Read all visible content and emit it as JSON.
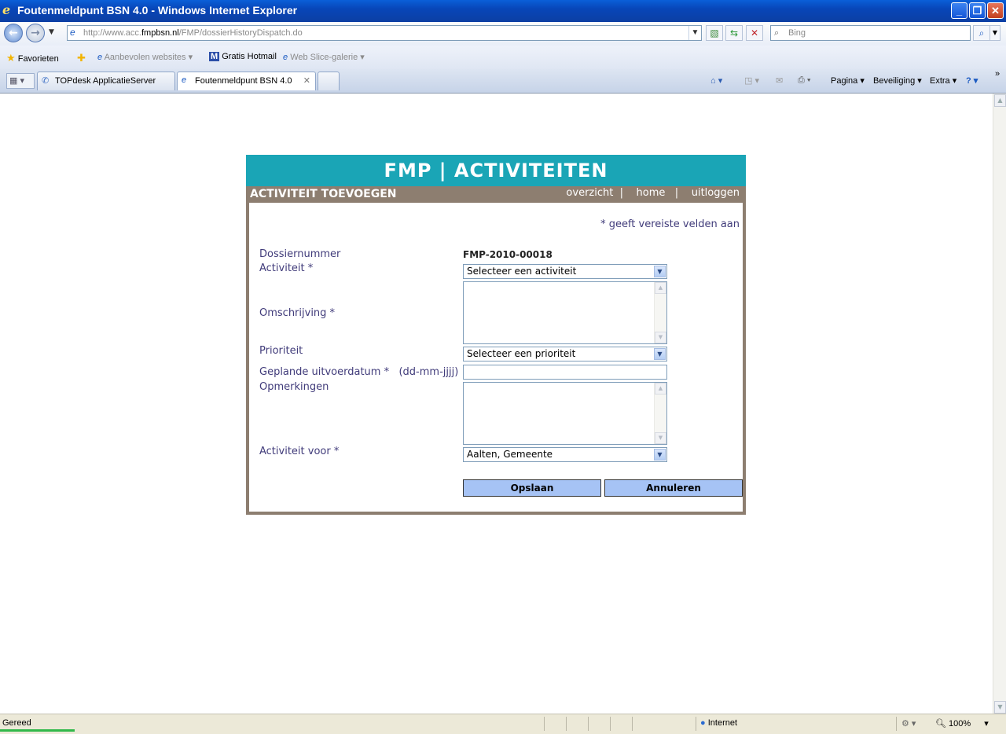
{
  "window": {
    "title": "Foutenmeldpunt BSN 4.0 - Windows Internet Explorer",
    "minimize": "_",
    "restore": "❐",
    "close": "✕"
  },
  "address": {
    "url_prefix": "http://www.acc.",
    "url_domain": "fmpbsn.nl",
    "url_suffix": "/FMP/dossierHistoryDispatch.do",
    "search_placeholder": "Bing"
  },
  "favorites": {
    "favorites_label": "Favorieten",
    "recommended": "Aanbevolen websites",
    "hotmail": "Gratis Hotmail",
    "slice_gallery": "Web Slice-galerie"
  },
  "tabs": [
    {
      "label": "TOPdesk ApplicatieServer"
    },
    {
      "label": "Foutenmeldpunt BSN 4.0"
    }
  ],
  "commandbar": {
    "page": "Pagina",
    "security": "Beveiliging",
    "extra": "Extra"
  },
  "status": {
    "text": "Gereed",
    "zone": "Internet",
    "zoom": "100%"
  },
  "panel": {
    "header": "FMP | ACTIVITEITEN",
    "subheader": "ACTIVITEIT TOEVOEGEN",
    "links": {
      "overview": "overzicht",
      "home": "home",
      "logout": "uitloggen"
    },
    "required_note": "* geeft vereiste velden aan",
    "form": {
      "dossier_label": "Dossiernummer",
      "dossier_value": "FMP-2010-00018",
      "activity_label": "Activiteit *",
      "activity_value": "Selecteer een activiteit",
      "description_label": "Omschrijving *",
      "priority_label": "Prioriteit",
      "priority_value": "Selecteer een prioriteit",
      "planned_date_label": "Geplande uitvoerdatum *   (dd-mm-jjjj)",
      "remarks_label": "Opmerkingen",
      "activity_for_label": "Activiteit voor *",
      "activity_for_value": "Aalten, Gemeente"
    },
    "buttons": {
      "save": "Opslaan",
      "cancel": "Annuleren"
    }
  },
  "colors": {
    "panel_header": "#1aa5b6",
    "panel_frame": "#8d7e70",
    "label_text": "#403b7a",
    "button": "#a6c3f5"
  }
}
